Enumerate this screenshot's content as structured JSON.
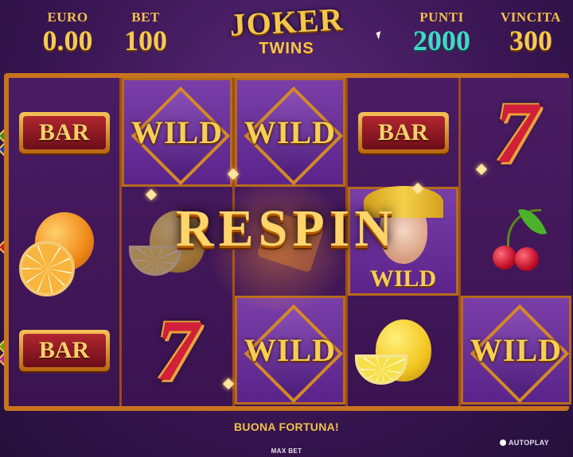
{
  "hud": {
    "euro": {
      "label": "EURO",
      "value": "0.00"
    },
    "bet": {
      "label": "BET",
      "value": "100"
    },
    "punti": {
      "label": "PUNTI",
      "value": "2000"
    },
    "vincita": {
      "label": "VINCITA",
      "value": "300"
    }
  },
  "logo": {
    "line1": "JOKER",
    "line2": "TWINS"
  },
  "reels": [
    [
      "BAR",
      "orange",
      "BAR"
    ],
    [
      "WILD",
      "lemon",
      "seven"
    ],
    [
      "WILD",
      "joker-card",
      "WILD"
    ],
    [
      "BAR",
      "joker-wild",
      "lemon"
    ],
    [
      "seven",
      "cherry",
      "WILD"
    ]
  ],
  "symbols": {
    "bar": "BAR",
    "wild": "WILD",
    "seven": "7"
  },
  "banner": {
    "text": "RESPIN"
  },
  "bottom": {
    "message": "BUONA FORTUNA!",
    "autoplay": "AUTOPLAY",
    "maxbet": "MAX BET"
  },
  "colors": {
    "gold": "#f5c94e",
    "teal": "#3fd9c6",
    "frame": "#c8741e",
    "purple": "#3d1752"
  }
}
